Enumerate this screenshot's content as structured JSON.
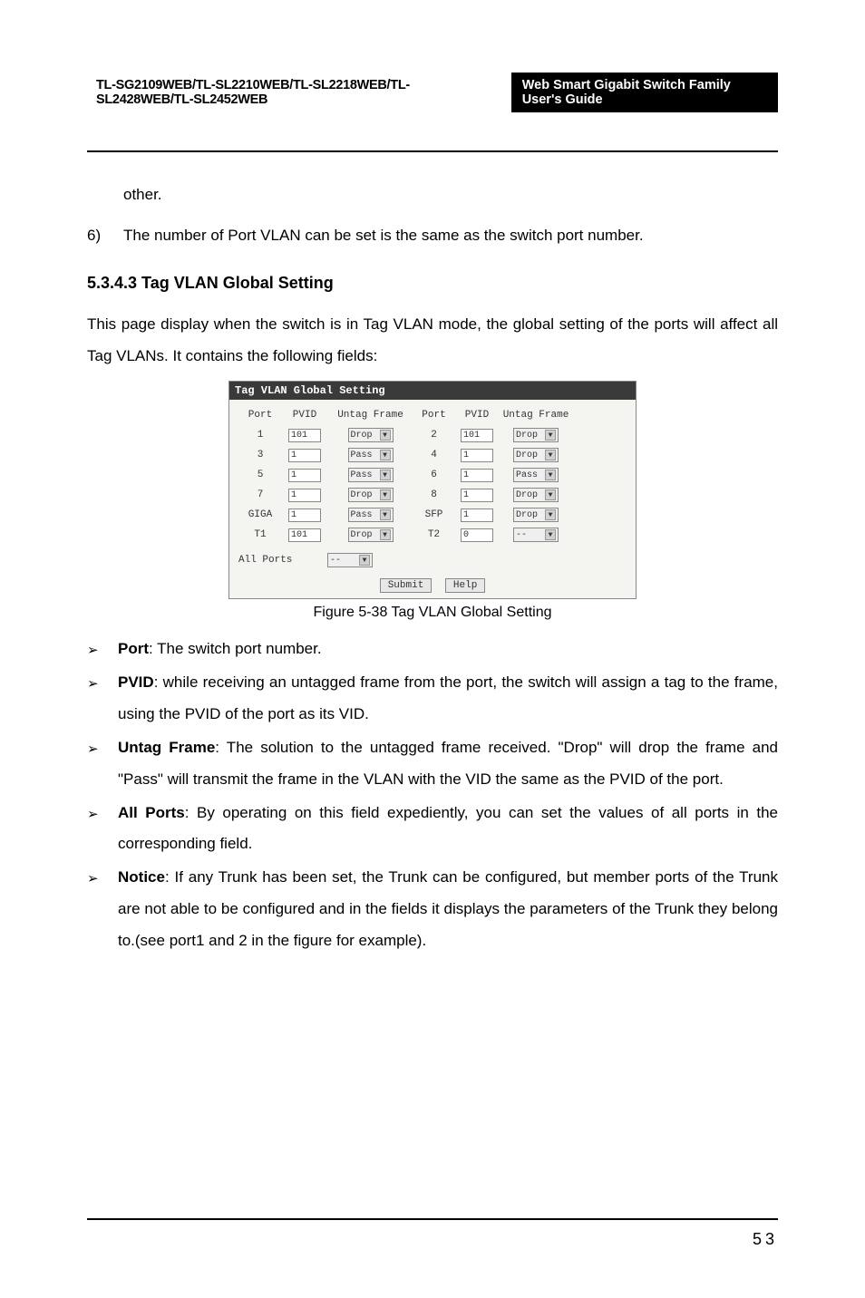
{
  "header": {
    "left": "TL-SG2109WEB/TL-SL2210WEB/TL-SL2218WEB/TL-SL2428WEB/TL-SL2452WEB",
    "right": "Web Smart Gigabit Switch Family User's Guide"
  },
  "para_other": "other.",
  "item6_num": "6)",
  "item6_text": "The number of Port VLAN can be set is the same as the switch port number.",
  "section_heading": "5.3.4.3  Tag VLAN Global Setting",
  "intro": "This page display when the switch is in Tag VLAN mode, the global setting of the ports will affect all Tag VLANs. It contains the following fields:",
  "figure_caption": "Figure 5-38 Tag VLAN Global Setting",
  "bullets": {
    "port_label": "Port",
    "port_text": ": The switch port number.",
    "pvid_label": "PVID",
    "pvid_text": ": while receiving an untagged frame from the port, the switch will assign a tag to the frame, using the PVID of the port as its VID.",
    "untag_label": "Untag Frame",
    "untag_text": ": The solution to the untagged frame received. \"Drop\" will drop the frame and \"Pass\" will transmit the frame in the VLAN with the VID the same as the PVID of the port.",
    "allports_label": "All Ports",
    "allports_text": ": By operating on this field expediently, you can set the values of all ports in the corresponding field.",
    "notice_label": "Notice",
    "notice_text": ": If any Trunk has been set, the Trunk can be configured, but member ports of the Trunk are not able to be configured and in the fields it displays the parameters of the Trunk they belong to.(see port1 and 2 in the figure for example)."
  },
  "vlan": {
    "title": "Tag VLAN Global Setting",
    "hdr_port": "Port",
    "hdr_pvid": "PVID",
    "hdr_untag": "Untag Frame",
    "rows": [
      {
        "p1": "1",
        "v1": "101",
        "u1": "Drop",
        "p2": "2",
        "v2": "101",
        "u2": "Drop"
      },
      {
        "p1": "3",
        "v1": "1",
        "u1": "Pass",
        "p2": "4",
        "v2": "1",
        "u2": "Drop"
      },
      {
        "p1": "5",
        "v1": "1",
        "u1": "Pass",
        "p2": "6",
        "v2": "1",
        "u2": "Pass"
      },
      {
        "p1": "7",
        "v1": "1",
        "u1": "Drop",
        "p2": "8",
        "v2": "1",
        "u2": "Drop"
      },
      {
        "p1": "GIGA",
        "v1": "1",
        "u1": "Pass",
        "p2": "SFP",
        "v2": "1",
        "u2": "Drop"
      },
      {
        "p1": "T1",
        "v1": "101",
        "u1": "Drop",
        "p2": "T2",
        "v2": "0",
        "u2": "--"
      }
    ],
    "allports_label": "All Ports",
    "allports_value": "--",
    "submit": "Submit",
    "help": "Help"
  },
  "page_number": "53",
  "chart_data": {
    "type": "table",
    "title": "Tag VLAN Global Setting",
    "columns": [
      "Port",
      "PVID",
      "Untag Frame"
    ],
    "rows": [
      {
        "Port": "1",
        "PVID": "101",
        "Untag Frame": "Drop"
      },
      {
        "Port": "2",
        "PVID": "101",
        "Untag Frame": "Drop"
      },
      {
        "Port": "3",
        "PVID": "1",
        "Untag Frame": "Pass"
      },
      {
        "Port": "4",
        "PVID": "1",
        "Untag Frame": "Drop"
      },
      {
        "Port": "5",
        "PVID": "1",
        "Untag Frame": "Pass"
      },
      {
        "Port": "6",
        "PVID": "1",
        "Untag Frame": "Pass"
      },
      {
        "Port": "7",
        "PVID": "1",
        "Untag Frame": "Drop"
      },
      {
        "Port": "8",
        "PVID": "1",
        "Untag Frame": "Drop"
      },
      {
        "Port": "GIGA",
        "PVID": "1",
        "Untag Frame": "Pass"
      },
      {
        "Port": "SFP",
        "PVID": "1",
        "Untag Frame": "Drop"
      },
      {
        "Port": "T1",
        "PVID": "101",
        "Untag Frame": "Drop"
      },
      {
        "Port": "T2",
        "PVID": "0",
        "Untag Frame": "--"
      }
    ],
    "all_ports": "--",
    "buttons": [
      "Submit",
      "Help"
    ]
  }
}
